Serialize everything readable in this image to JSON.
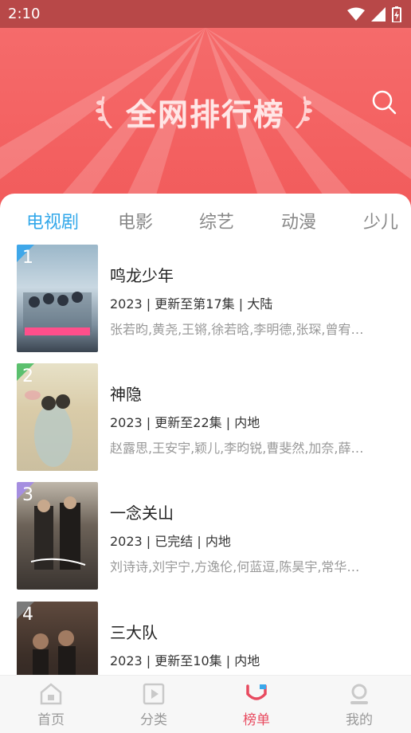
{
  "status_bar": {
    "time": "2:10"
  },
  "header": {
    "title": "全网排行榜"
  },
  "tabs": [
    {
      "label": "电视剧"
    },
    {
      "label": "电影"
    },
    {
      "label": "综艺"
    },
    {
      "label": "动漫"
    },
    {
      "label": "少儿"
    }
  ],
  "list": [
    {
      "rank": "1",
      "title": "鸣龙少年",
      "meta": "2023 | 更新至第17集 | 大陆",
      "cast": "张若昀,黄尧,王锵,徐若晗,李明德,张琛,曾宥…"
    },
    {
      "rank": "2",
      "title": "神隐",
      "meta": "2023 | 更新至22集 | 内地",
      "cast": "赵露思,王安宇,颖儿,李昀锐,曹斐然,加奈,薛…"
    },
    {
      "rank": "3",
      "title": "一念关山",
      "meta": "2023 | 已完结 | 内地",
      "cast": "刘诗诗,刘宇宁,方逸伦,何蓝逗,陈昊宇,常华…"
    },
    {
      "rank": "4",
      "title": "三大队",
      "meta": "2023 | 更新至10集 | 内地",
      "cast": ""
    }
  ],
  "bottom_nav": [
    {
      "label": "首页",
      "icon": "home-icon"
    },
    {
      "label": "分类",
      "icon": "play-icon"
    },
    {
      "label": "榜单",
      "icon": "ranking-icon"
    },
    {
      "label": "我的",
      "icon": "profile-icon"
    }
  ],
  "colors": {
    "accent": "#33a8ea",
    "brand_red": "#f25b5b",
    "nav_active": "#e84a5f"
  }
}
